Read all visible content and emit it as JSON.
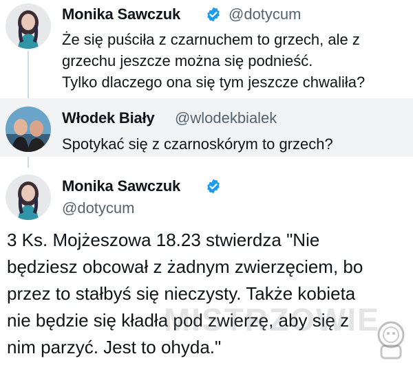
{
  "tweets": [
    {
      "author": "Monika Sawczuk",
      "handle": "@dotycum",
      "verified": true,
      "lines": [
        "Że się puściła z czarnuchem to grzech, ale z",
        "grzechu jeszcze można się podnieść.",
        "Tylko dlaczego ona się tym jeszcze chwaliła?"
      ]
    },
    {
      "author": "Włodek Biały",
      "handle": "@wlodekbialek",
      "verified": false,
      "lines": [
        "Spotykać się z czarnoskórym to grzech?"
      ]
    },
    {
      "author": "Monika Sawczuk",
      "handle": "@dotycum",
      "verified": true,
      "lines": [
        "3 Ks. Mojżeszowa 18.23 stwierdza \"Nie",
        "będziesz obcował z żadnym zwierzęciem, bo",
        "przez to stałbyś się  nieczysty. Także kobieta",
        "nie będzie się kładła pod zwierzę, aby się z",
        "nim parzyć. Jest to ohyda.\""
      ]
    }
  ],
  "watermark": "MISTRZOWIE",
  "colors": {
    "verified": "#1d9bf0",
    "handle": "#536471",
    "thread_line": "#cfd9de"
  }
}
